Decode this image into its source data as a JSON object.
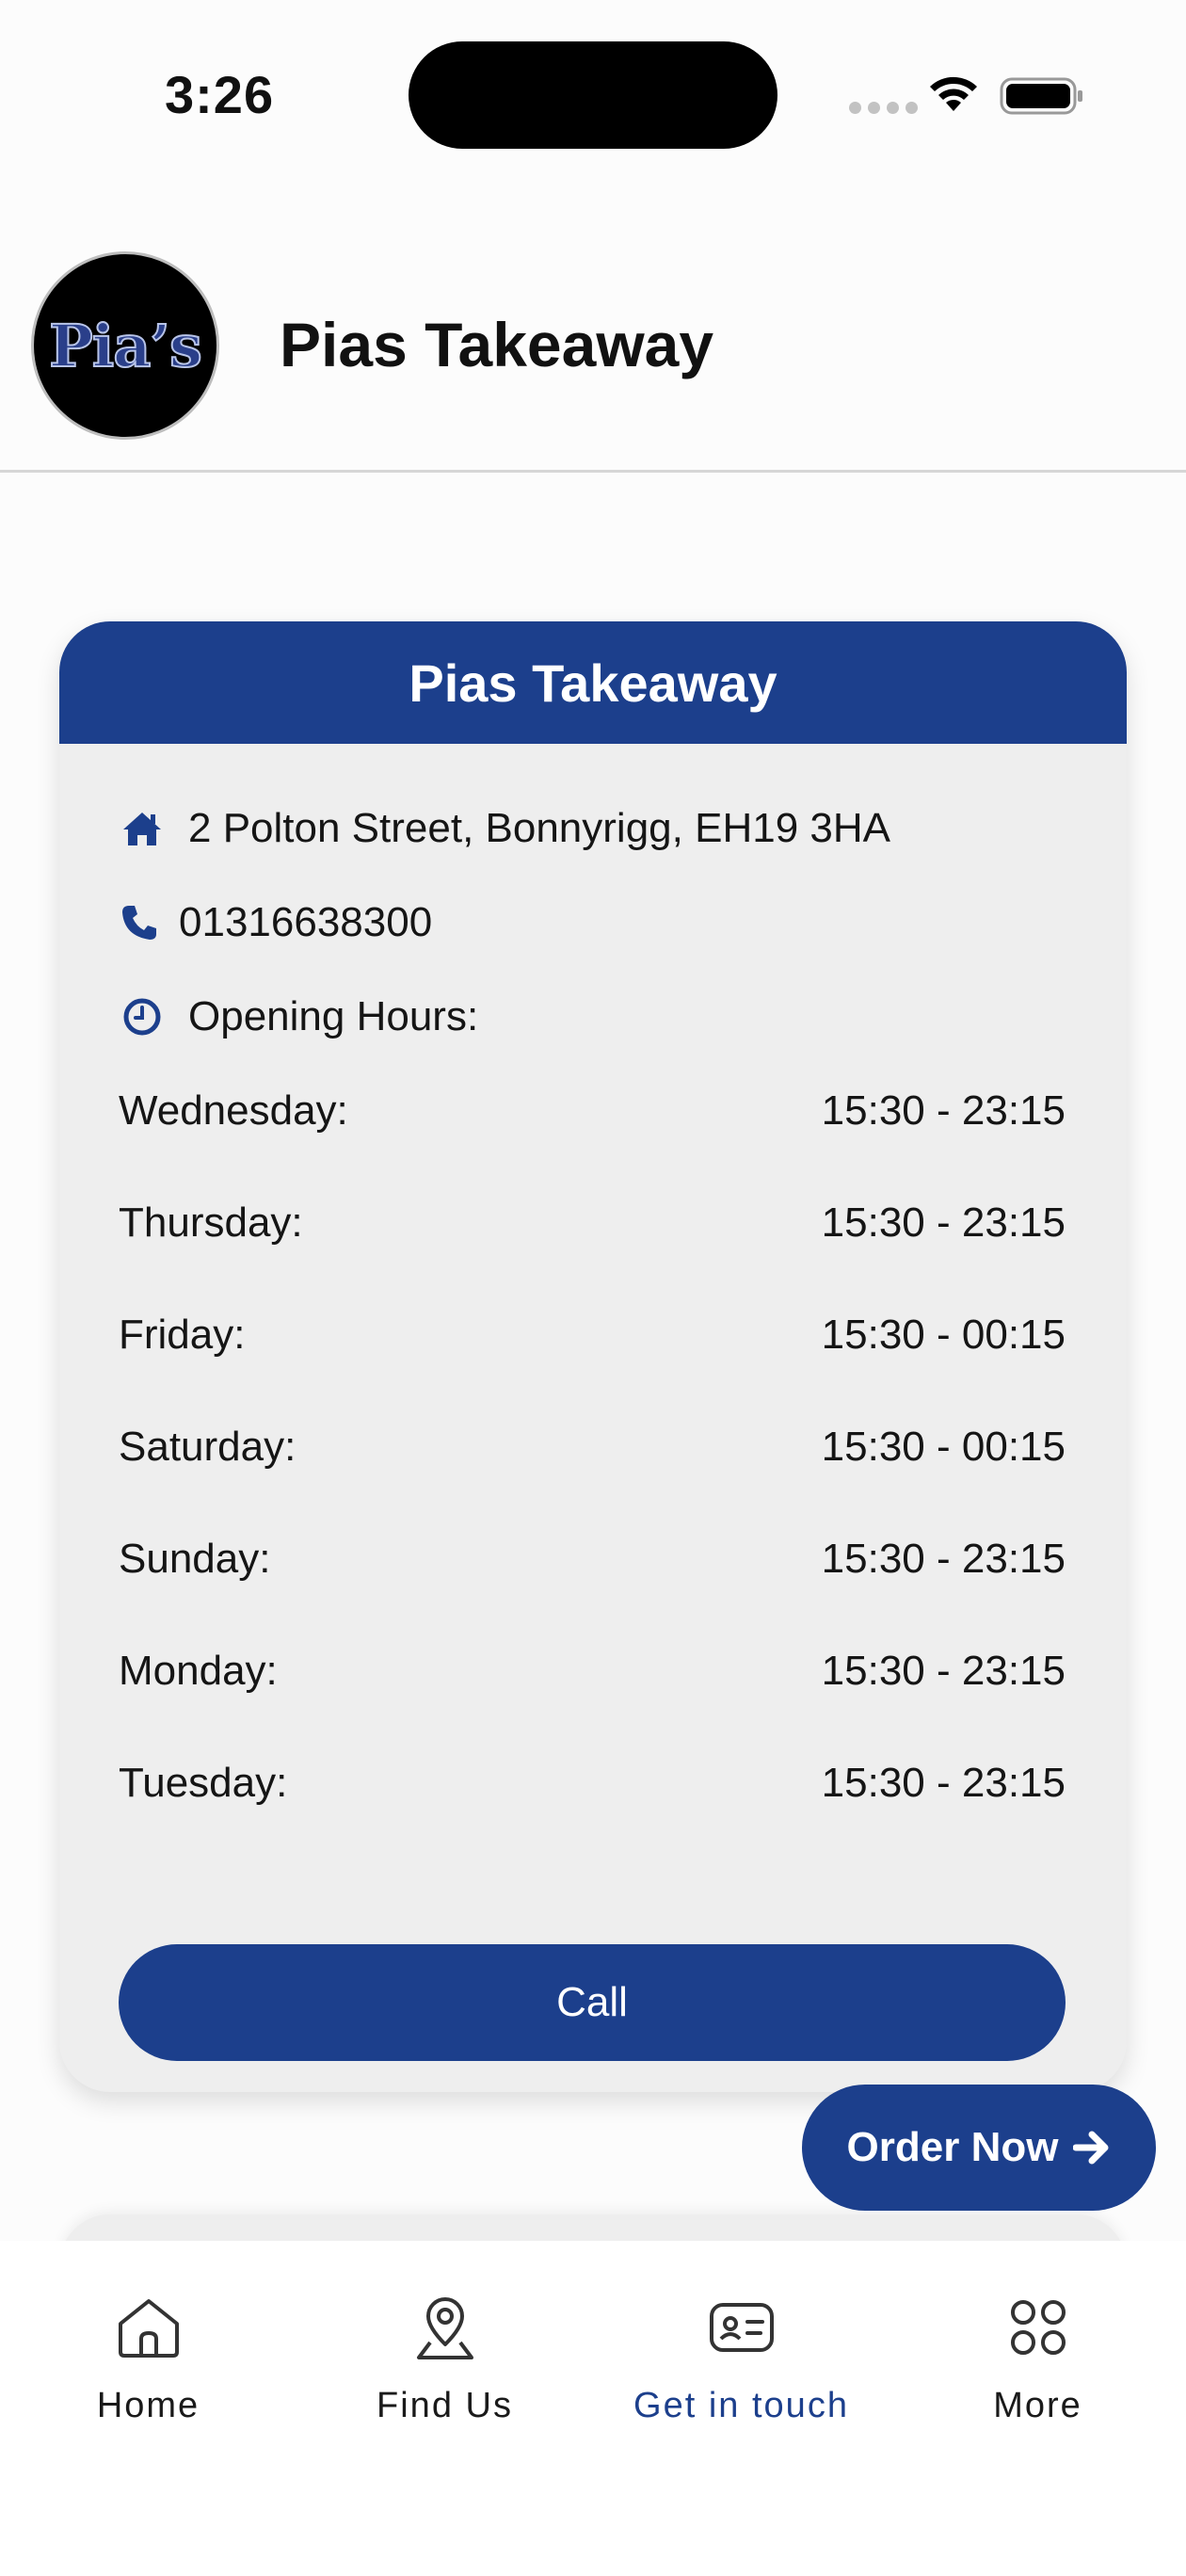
{
  "status_bar": {
    "time": "3:26"
  },
  "header": {
    "logo_text": "Pia’s",
    "title": "Pias Takeaway"
  },
  "card": {
    "title": "Pias Takeaway",
    "address": "2 Polton Street, Bonnyrigg, EH19 3HA",
    "phone": "01316638300",
    "hours_label": "Opening Hours:",
    "hours": [
      {
        "day": "Wednesday:",
        "time": "15:30 - 23:15"
      },
      {
        "day": "Thursday:",
        "time": "15:30 - 23:15"
      },
      {
        "day": "Friday:",
        "time": "15:30 - 00:15"
      },
      {
        "day": "Saturday:",
        "time": "15:30 - 00:15"
      },
      {
        "day": "Sunday:",
        "time": "15:30 - 23:15"
      },
      {
        "day": "Monday:",
        "time": "15:30 - 23:15"
      },
      {
        "day": "Tuesday:",
        "time": "15:30 - 23:15"
      }
    ],
    "call_label": "Call"
  },
  "order_button": {
    "label": "Order Now"
  },
  "nav": {
    "items": [
      {
        "label": "Home",
        "icon": "home-icon"
      },
      {
        "label": "Find Us",
        "icon": "location-pin-icon"
      },
      {
        "label": "Get in touch",
        "icon": "contact-card-icon",
        "active": true
      },
      {
        "label": "More",
        "icon": "grid-icon"
      }
    ]
  },
  "colors": {
    "primary": "#1c3f8c",
    "card_bg": "#eeeeee",
    "page_bg": "#fcfcfc"
  }
}
